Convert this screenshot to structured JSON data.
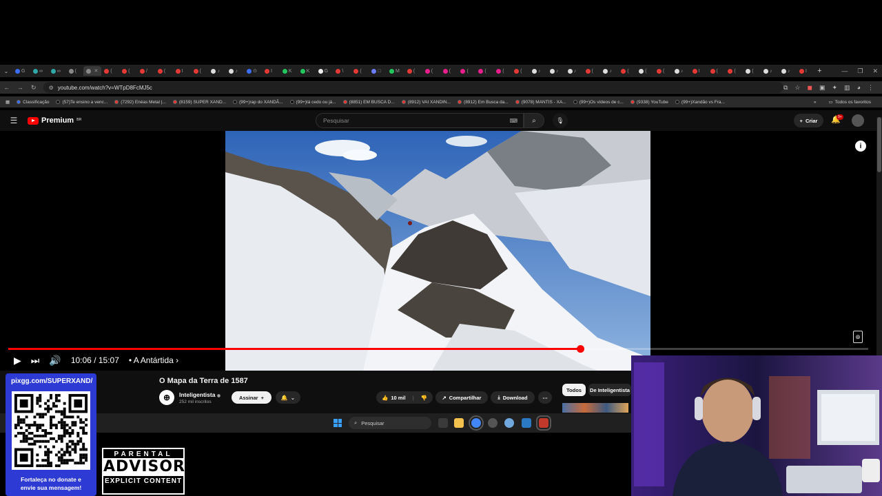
{
  "browser": {
    "tabs": [
      "G",
      "∞",
      "∞",
      "(",
      "",
      "(",
      "(",
      "/",
      "(",
      "I",
      "(",
      "♪",
      "♪",
      "⊙",
      "I",
      "K",
      "K",
      "G",
      "\\",
      "(",
      "□",
      "M",
      "(",
      "(",
      "(",
      "(",
      "(",
      "(",
      "(",
      "♪",
      "♪",
      "♪",
      "(",
      "♪",
      "(",
      "(",
      "(",
      "♪",
      "I",
      "(",
      "(",
      "(",
      "♪",
      "♪",
      "I"
    ],
    "active_tab_index": 4,
    "url": "youtube.com/watch?v=WTpD8FcMJ5c",
    "bookmarks": [
      {
        "label": "Classificação",
        "color": "#3b6ef5"
      },
      {
        "label": "(57)Te ensino a venc...",
        "color": "#111"
      },
      {
        "label": "(7292) Enéas Metal |...",
        "color": "#e53935"
      },
      {
        "label": "(8159) SUPER XAND...",
        "color": "#e53935"
      },
      {
        "label": "(99+)rap do XANDÃ...",
        "color": "#111"
      },
      {
        "label": "(99+)tá cedo ou já...",
        "color": "#111"
      },
      {
        "label": "(8851) EM BUSCA D...",
        "color": "#e53935"
      },
      {
        "label": "(8912) VAI XANDIN...",
        "color": "#e53935"
      },
      {
        "label": "(8912) Em Busca da...",
        "color": "#e53935"
      },
      {
        "label": "(9078) MANTIS - XA...",
        "color": "#e53935"
      },
      {
        "label": "(99+)Os vídeos de c...",
        "color": "#111"
      },
      {
        "label": "(9338) YouTube",
        "color": "#e53935"
      },
      {
        "label": "(99+)Xandão vs Fra...",
        "color": "#111"
      }
    ],
    "bookmarks_more": "»",
    "all_bookmarks": "Todos os favoritos"
  },
  "youtube": {
    "logo_text": "Premium",
    "logo_sup": "BR",
    "search_placeholder": "Pesquisar",
    "create_label": "Criar",
    "notif_count": "9+"
  },
  "player": {
    "time_current": "10:06",
    "time_total": "15:07",
    "time_sep": " / ",
    "chapter": "• A Antártida ›",
    "progress_fraction": 0.665
  },
  "video": {
    "title": "O Mapa da Terra de 1587",
    "channel_name": "Inteligentista",
    "channel_verified": "◉",
    "subscribers": "252 mil inscritos",
    "subscribe_label": "Assinar",
    "like_count": "10 mil",
    "share_label": "Compartilhar",
    "download_label": "Download",
    "chips": [
      "Todos",
      "De Inteligentista"
    ]
  },
  "taskbar": {
    "search_placeholder": "Pesquisar"
  },
  "overlay": {
    "qr_url": "pixgg.com/SUPERXAND/",
    "qr_caption_1": "Fortaleça no donate e",
    "qr_caption_2": "envie sua mensagem!",
    "advisory_top": "PARENTAL",
    "advisory_mid": "ADVISORY",
    "advisory_bottom": "EXPLICIT CONTENT"
  }
}
